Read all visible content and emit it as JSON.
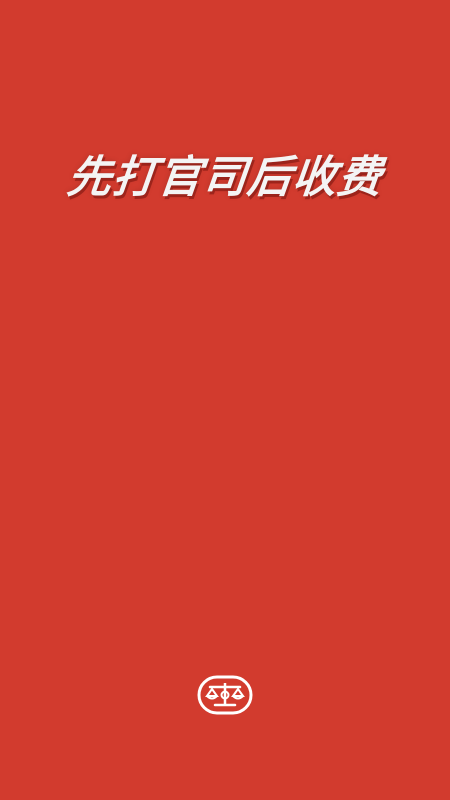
{
  "splash": {
    "slogan": "先打官司后收费",
    "logo_icon": "justice-scale-logo-icon",
    "colors": {
      "background": "#d23b2e",
      "text": "#f4f4f4",
      "logo": "#ffffff"
    }
  }
}
